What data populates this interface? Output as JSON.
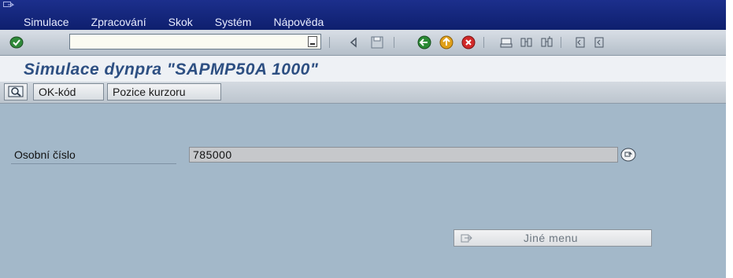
{
  "menubar": {
    "items": [
      "Simulace",
      "Zpracování",
      "Skok",
      "Systém",
      "Nápověda"
    ]
  },
  "toolbar": {
    "command_value": ""
  },
  "title": {
    "text": "Simulace dynpra \"SAPMP50A 1000\""
  },
  "app_toolbar": {
    "ok_code_label": "OK-kód",
    "cursor_label": "Pozice kurzoru"
  },
  "form": {
    "personnel_number_label": "Osobní číslo",
    "personnel_number_value": "785000"
  },
  "other_menu": {
    "label": "Jiné menu"
  },
  "colors": {
    "menubar": "#1c2f8c",
    "title": "#2d4f82",
    "main_bg": "#a3b8c9"
  }
}
